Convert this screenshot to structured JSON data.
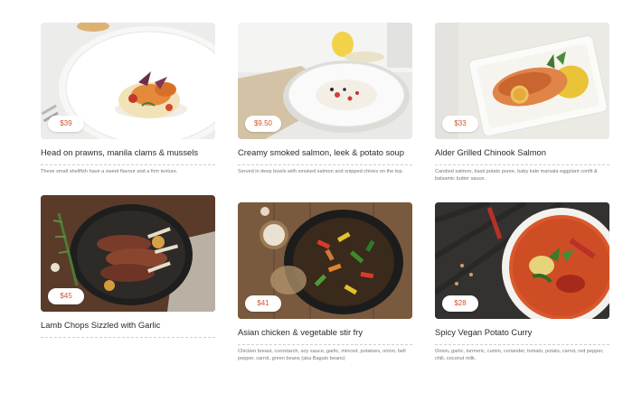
{
  "menu": [
    {
      "title": "Head on prawns, manila clams & mussels",
      "price": "$39",
      "description": "These small shellfish have a sweet flavour and a firm texture.",
      "image": "prawns-dish-photo"
    },
    {
      "title": "Creamy smoked salmon, leek & potato soup",
      "price": "$9.50",
      "description": "Served in deep bowls with smoked salmon and snipped chives on the top.",
      "image": "soup-bowl-photo"
    },
    {
      "title": "Alder Grilled Chinook Salmon",
      "price": "$33",
      "description": "Candied salmon, basil potato puree, baby kale marsala eggplant confit & balsamic butter sauce.",
      "image": "grilled-salmon-photo"
    },
    {
      "title": "Lamb Chops Sizzled with Garlic",
      "price": "$45",
      "description": "",
      "image": "lamb-chops-photo"
    },
    {
      "title": "Asian chicken & vegetable stir fry",
      "price": "$41",
      "description": "Chicken breast, cornstarch, soy sauce, garlic, minced, potatoes, onion, bell pepper, carrot, green beans (aka Baguio beans)",
      "image": "stir-fry-photo"
    },
    {
      "title": "Spicy Vegan Potato Curry",
      "price": "$28",
      "description": "Onion, garlic, turmeric, cumin, coriander, tomato, potato, carrot, red pepper, chili, coconut milk.",
      "image": "curry-bowl-photo"
    }
  ],
  "colors": {
    "price_text": "#d4532b",
    "title_text": "#2b2b2b",
    "description_text": "#777777"
  }
}
